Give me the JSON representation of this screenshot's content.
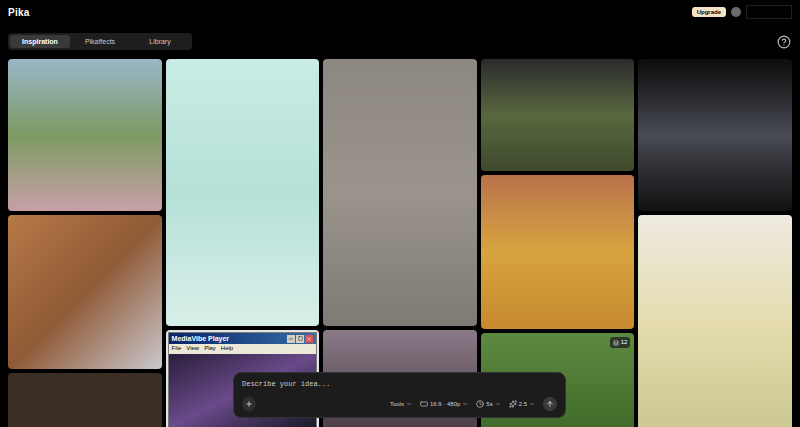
{
  "header": {
    "logo": "Pika",
    "upgrade_button": "Upgrade"
  },
  "tabs": [
    {
      "label": "Inspiration",
      "selected": true
    },
    {
      "label": "Pikaffects",
      "selected": false
    },
    {
      "label": "Library",
      "selected": false
    }
  ],
  "media_player": {
    "title": "MediaVibe Player",
    "menu": [
      "File",
      "View",
      "Play",
      "Help"
    ]
  },
  "tile_badge": "12",
  "prompt": {
    "placeholder": "Describe your idea...",
    "options": [
      {
        "label": "Tools",
        "kind": "plain"
      },
      {
        "label": "16:9 · 480p",
        "kind": "aspect"
      },
      {
        "label": "5s",
        "kind": "duration"
      },
      {
        "label": "2.5",
        "kind": "model"
      }
    ]
  }
}
